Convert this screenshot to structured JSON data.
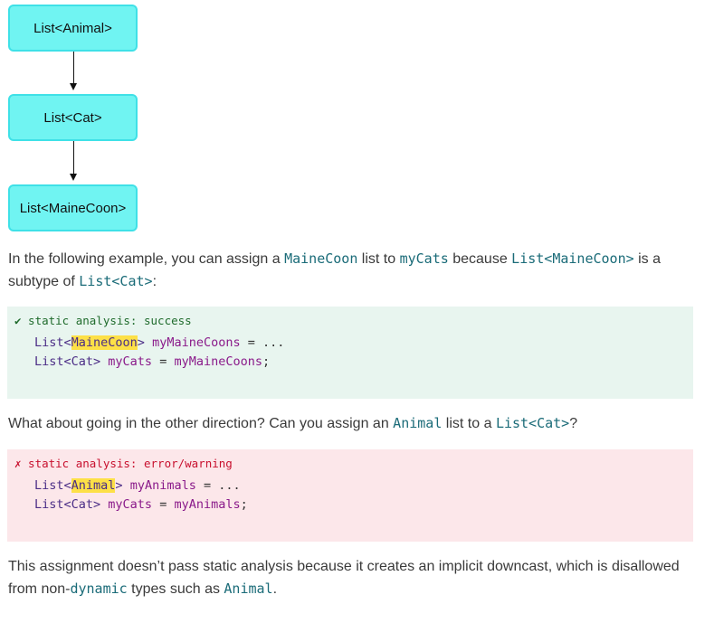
{
  "diagram": {
    "nodes": [
      "List<Animal>",
      "List<Cat>",
      "List<MaineCoon>"
    ]
  },
  "para1": {
    "t1": "In the following example, you can assign a ",
    "c1": "MaineCoon",
    "t2": " list to ",
    "c2": "myCats",
    "t3": " because ",
    "c3": "List<MaineCoon>",
    "t4": " is a subtype of ",
    "c4": "List<Cat>",
    "t5": ":"
  },
  "success_box": {
    "status": "✔ static analysis: success",
    "line1": {
      "a": "List<",
      "hl": "MaineCoon",
      "b": "> ",
      "id": "myMaineCoons",
      "c": " = ..."
    },
    "line2": {
      "a": "List<Cat> ",
      "id": "myCats",
      "b": " = ",
      "id2": "myMaineCoons",
      "c": ";"
    }
  },
  "para2": {
    "t1": "What about going in the other direction? Can you assign an ",
    "c1": "Animal",
    "t2": " list to a ",
    "c2": "List<Cat>",
    "t3": "?"
  },
  "error_box": {
    "status": "✗ static analysis: error/warning",
    "line1": {
      "a": "List<",
      "hl": "Animal",
      "b": "> ",
      "id": "myAnimals",
      "c": " = ..."
    },
    "line2": {
      "a": "List<Cat> ",
      "id": "myCats",
      "b": " = ",
      "id2": "myAnimals",
      "c": ";"
    }
  },
  "para3": {
    "t1": "This assignment doesn’t pass static analysis because it creates an implicit downcast, which is disallowed from non-",
    "c1": "dynamic",
    "t2": " types such as ",
    "c2": "Animal",
    "t3": "."
  }
}
